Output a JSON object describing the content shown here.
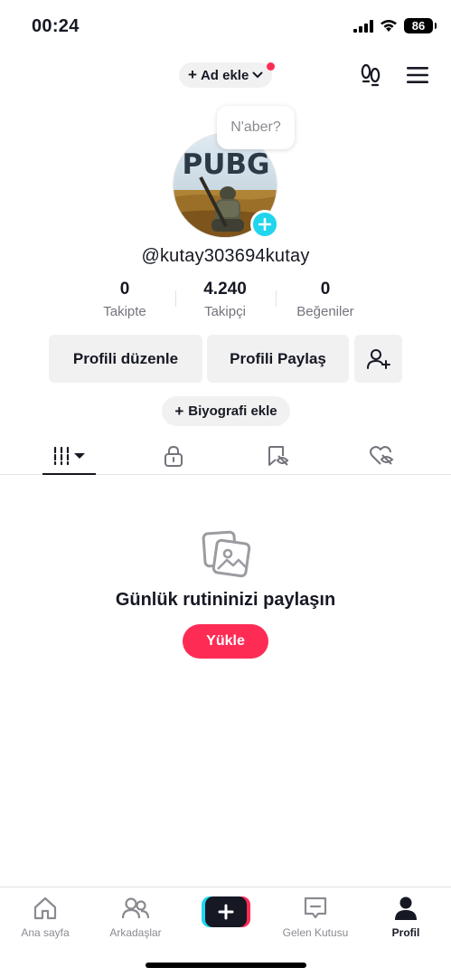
{
  "status_bar": {
    "time": "00:24",
    "battery": "86"
  },
  "header": {
    "add_account_label": "Ad ekle",
    "plus": "+"
  },
  "note_bubble": "N'aber?",
  "avatar": {
    "text": "PUBG"
  },
  "profile": {
    "username": "@kutay303694kutay"
  },
  "stats": [
    {
      "value": "0",
      "label": "Takipte"
    },
    {
      "value": "4.240",
      "label": "Takipçi"
    },
    {
      "value": "0",
      "label": "Beğeniler"
    }
  ],
  "actions": {
    "edit": "Profili düzenle",
    "share": "Profili Paylaş"
  },
  "bio": {
    "plus": "+",
    "label": "Biyografi ekle"
  },
  "empty_state": {
    "title": "Günlük rutininizi paylaşın",
    "button": "Yükle"
  },
  "bottom_nav": [
    {
      "label": "Ana sayfa",
      "icon": "home-icon"
    },
    {
      "label": "Arkadaşlar",
      "icon": "friends-icon"
    },
    {
      "label": "",
      "icon": "create-icon"
    },
    {
      "label": "Gelen Kutusu",
      "icon": "inbox-icon"
    },
    {
      "label": "Profil",
      "icon": "profile-icon"
    }
  ],
  "colors": {
    "accent": "#fe2c55",
    "cyan": "#20d5ec",
    "text": "#161823",
    "muted": "#73747b"
  }
}
